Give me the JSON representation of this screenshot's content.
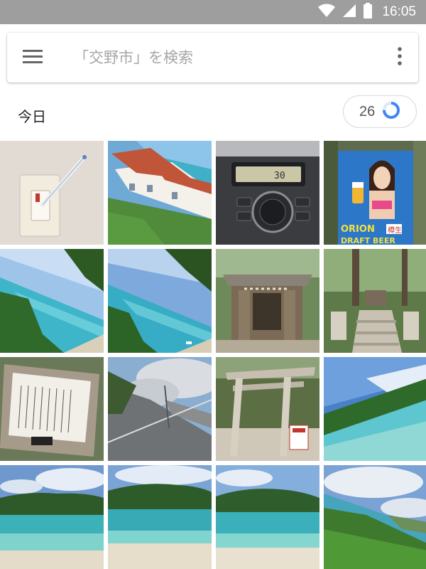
{
  "status_bar": {
    "time": "16:05",
    "icons": [
      "wifi-icon",
      "cell-signal-icon",
      "battery-icon"
    ]
  },
  "search": {
    "placeholder": "「交野市」を検索",
    "menu_icon": "hamburger-menu-icon",
    "more_icon": "more-vert-icon"
  },
  "section": {
    "title": "今日",
    "count": "26",
    "progress_icon": "loading-ring-icon"
  },
  "photos": [
    {
      "label": "light-switch-with-pen"
    },
    {
      "label": "red-roof-building-by-sea"
    },
    {
      "label": "car-ac-panel"
    },
    {
      "label": "orion-beer-poster"
    },
    {
      "label": "tilted-beach-view-1"
    },
    {
      "label": "tilted-beach-view-2"
    },
    {
      "label": "wooden-shrine"
    },
    {
      "label": "stone-steps-shrine"
    },
    {
      "label": "stone-inscription-sign"
    },
    {
      "label": "road-and-cloudy-sky"
    },
    {
      "label": "torii-gate"
    },
    {
      "label": "tilted-bay-view"
    },
    {
      "label": "island-beach-1"
    },
    {
      "label": "island-beach-2"
    },
    {
      "label": "island-beach-3"
    },
    {
      "label": "bay-with-clouds"
    }
  ],
  "signs": {
    "poster_text_1": "ORION",
    "poster_text_2": "DRAFT BEER",
    "poster_badge": "樽生",
    "ac_readout": "30"
  },
  "colors": {
    "status_bar": "#9e9e9e",
    "accent_blue": "#4285f4",
    "sea_blue": "#3fb0c8"
  }
}
